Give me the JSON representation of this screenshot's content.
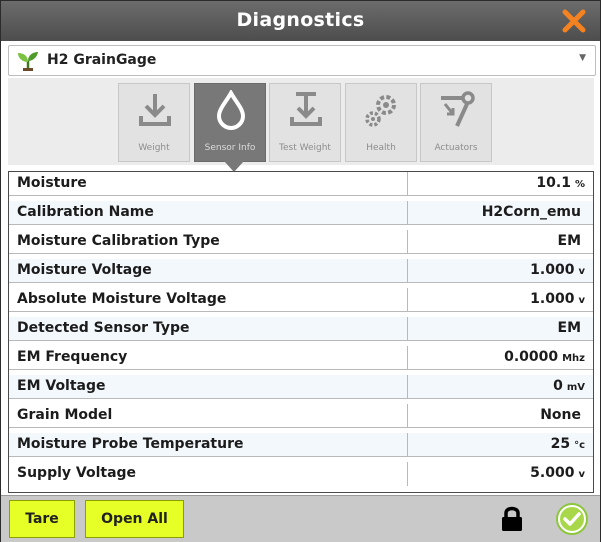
{
  "window": {
    "title": "Diagnostics"
  },
  "selector": {
    "value": "H2 GrainGage"
  },
  "tabs": [
    {
      "label": "Weight",
      "icon": "download-tray-icon",
      "active": false
    },
    {
      "label": "Sensor Info",
      "icon": "droplet-icon",
      "active": true
    },
    {
      "label": "Test Weight",
      "icon": "weight-press-icon",
      "active": false
    },
    {
      "label": "Health",
      "icon": "gears-icon",
      "active": false
    },
    {
      "label": "Actuators",
      "icon": "actuator-arm-icon",
      "active": false
    }
  ],
  "table": {
    "rows": [
      {
        "name": "Moisture",
        "value": "10.1",
        "unit": "%"
      },
      {
        "name": "Calibration Name",
        "value": "H2Corn_emu",
        "unit": ""
      },
      {
        "name": "Moisture Calibration Type",
        "value": "EM",
        "unit": ""
      },
      {
        "name": "Moisture Voltage",
        "value": "1.000",
        "unit": "v"
      },
      {
        "name": "Absolute Moisture Voltage",
        "value": "1.000",
        "unit": "v"
      },
      {
        "name": "Detected Sensor Type",
        "value": "EM",
        "unit": ""
      },
      {
        "name": "EM Frequency",
        "value": "0.0000",
        "unit": "Mhz"
      },
      {
        "name": "EM Voltage",
        "value": "0",
        "unit": "mV"
      },
      {
        "name": "Grain Model",
        "value": "None",
        "unit": ""
      },
      {
        "name": "Moisture Probe Temperature",
        "value": "25",
        "unit": "°c"
      },
      {
        "name": "Supply Voltage",
        "value": "5.000",
        "unit": "v"
      }
    ]
  },
  "footer": {
    "tare_label": "Tare",
    "open_all_label": "Open All"
  },
  "colors": {
    "titlebar": "#5a5a5a",
    "close": "#f58220",
    "button": "#e6ff27",
    "ok": "#a8d84a",
    "active_tab": "#787878"
  }
}
